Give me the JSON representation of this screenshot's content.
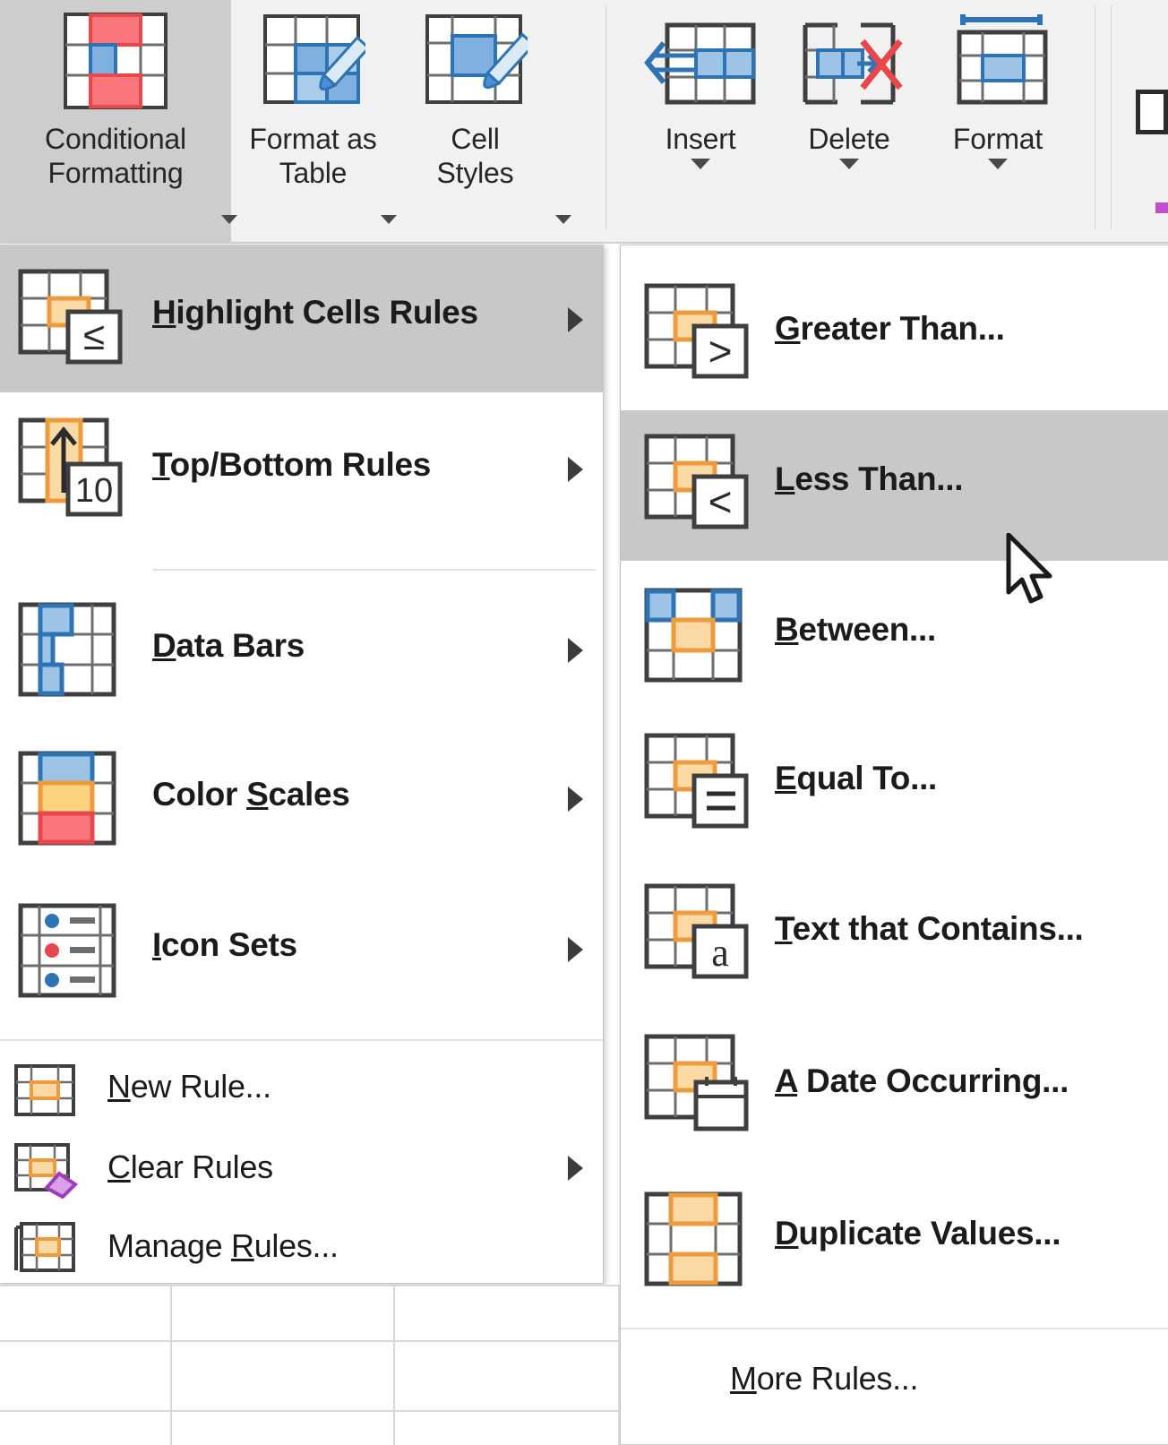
{
  "ribbon": {
    "buttons": [
      {
        "id": "conditional-formatting",
        "label": "Conditional\nFormatting",
        "icon": "conditional-formatting-icon",
        "has_caret_inline": true,
        "active": true
      },
      {
        "id": "format-as-table",
        "label": "Format as\nTable",
        "icon": "format-as-table-icon",
        "has_caret_inline": true,
        "active": false
      },
      {
        "id": "cell-styles",
        "label": "Cell\nStyles",
        "icon": "cell-styles-icon",
        "has_caret_inline": true,
        "active": false
      },
      {
        "id": "insert",
        "label": "Insert",
        "icon": "insert-cells-icon",
        "has_caret_below": true,
        "active": false
      },
      {
        "id": "delete",
        "label": "Delete",
        "icon": "delete-cells-icon",
        "has_caret_below": true,
        "active": false
      },
      {
        "id": "format",
        "label": "Format",
        "icon": "format-cells-icon",
        "has_caret_below": true,
        "active": false
      }
    ]
  },
  "main_menu": {
    "items": [
      {
        "id": "highlight-cells-rules",
        "label": "Highlight Cells Rules",
        "accel": "H",
        "icon": "highlight-cells-rules-icon",
        "submenu": true,
        "highlighted": true
      },
      {
        "id": "top-bottom-rules",
        "label": "Top/Bottom Rules",
        "accel": "T",
        "icon": "top-bottom-rules-icon",
        "submenu": true,
        "highlighted": false
      },
      {
        "id": "data-bars",
        "label": "Data Bars",
        "accel": "D",
        "icon": "data-bars-icon",
        "submenu": true,
        "highlighted": false
      },
      {
        "id": "color-scales",
        "label": "Color Scales",
        "accel": "S",
        "icon": "color-scales-icon",
        "submenu": true,
        "highlighted": false
      },
      {
        "id": "icon-sets",
        "label": "Icon Sets",
        "accel": "I",
        "icon": "icon-sets-icon",
        "submenu": true,
        "highlighted": false
      },
      {
        "id": "new-rule",
        "label": "New Rule...",
        "accel": "N",
        "icon": "new-rule-icon",
        "submenu": false,
        "highlighted": false
      },
      {
        "id": "clear-rules",
        "label": "Clear Rules",
        "accel": "C",
        "icon": "clear-rules-icon",
        "submenu": true,
        "highlighted": false
      },
      {
        "id": "manage-rules",
        "label": "Manage Rules...",
        "accel": "R",
        "icon": "manage-rules-icon",
        "submenu": false,
        "highlighted": false
      }
    ]
  },
  "sub_menu": {
    "items": [
      {
        "id": "greater-than",
        "label": "Greater Than...",
        "accel": "G",
        "icon": "greater-than-icon",
        "highlighted": false
      },
      {
        "id": "less-than",
        "label": "Less Than...",
        "accel": "L",
        "icon": "less-than-icon",
        "highlighted": true
      },
      {
        "id": "between",
        "label": "Between...",
        "accel": "B",
        "icon": "between-icon",
        "highlighted": false
      },
      {
        "id": "equal-to",
        "label": "Equal To...",
        "accel": "E",
        "icon": "equal-to-icon",
        "highlighted": false
      },
      {
        "id": "text-that-contains",
        "label": "Text that Contains...",
        "accel": "T",
        "icon": "text-that-contains-icon",
        "highlighted": false
      },
      {
        "id": "a-date-occurring",
        "label": "A Date Occurring...",
        "accel": "A",
        "icon": "a-date-occurring-icon",
        "highlighted": false
      },
      {
        "id": "duplicate-values",
        "label": "Duplicate Values...",
        "accel": "D",
        "icon": "duplicate-values-icon",
        "highlighted": false
      },
      {
        "id": "more-rules",
        "label": "More Rules...",
        "accel": "M",
        "icon": "",
        "highlighted": false
      }
    ]
  },
  "colors": {
    "accent_orange": "#ED9B3C",
    "fill_orange": "#FBD9A5",
    "accent_blue": "#4A90D9",
    "fill_blue": "#9DC3E6",
    "accent_red": "#E8484B",
    "fill_red": "#F9777A",
    "fill_yellow": "#FBD381",
    "purple": "#A03BB9",
    "grid_stroke": "#3F3F3F",
    "highlight_bg": "#C8C8C8",
    "menu_bg": "#FFFFFF",
    "ribbon_bg": "#F1F1F1"
  }
}
